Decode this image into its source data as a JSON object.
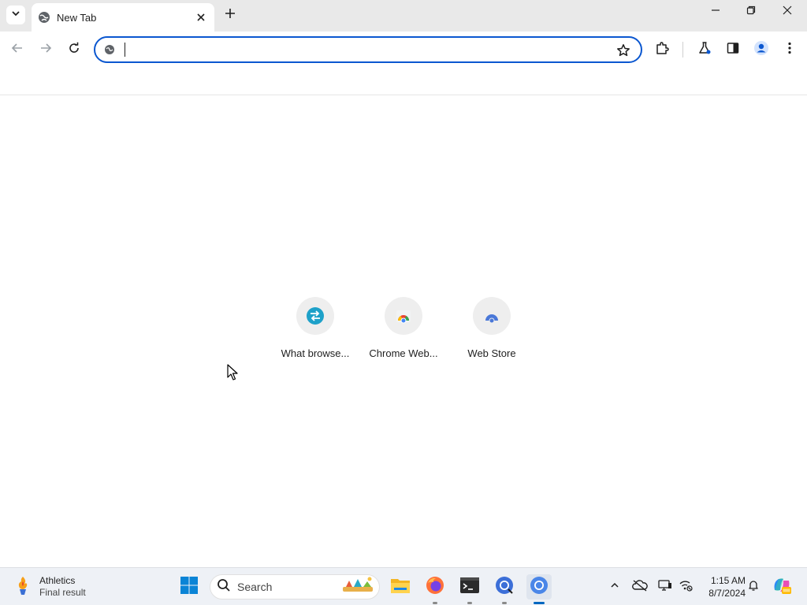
{
  "browser": {
    "tab": {
      "title": "New Tab",
      "close_icon": "close-icon",
      "favicon": "globe-icon"
    },
    "new_tab_icon": "plus-icon",
    "tab_search_icon": "chevron-down-icon",
    "window_controls": [
      "minimize-icon",
      "restore-icon",
      "close-icon"
    ],
    "toolbar": {
      "back_icon": "arrow-left-icon",
      "forward_icon": "arrow-right-icon",
      "reload_icon": "reload-icon",
      "omnibox_value": "",
      "omnibox_icon": "google-icon",
      "bookmark_icon": "star-icon",
      "extensions_icon": "puzzle-icon",
      "labs_icon": "flask-icon",
      "side_panel_icon": "side-panel-icon",
      "profile_icon": "person-icon",
      "menu_icon": "kebab-menu-icon"
    },
    "accent_color": "#0b57d0"
  },
  "shortcuts": [
    {
      "label": "What browse...",
      "icon": "globe-arrows-icon"
    },
    {
      "label": "Chrome Web...",
      "icon": "chrome-store-icon"
    },
    {
      "label": "Web Store",
      "icon": "webstore-icon"
    }
  ],
  "taskbar": {
    "widget": {
      "title": "Athletics",
      "subtitle": "Final result",
      "icon": "torch-icon"
    },
    "start_icon": "windows-icon",
    "search_label": "Search",
    "apps": [
      "file-explorer-icon",
      "firefox-icon",
      "terminal-icon",
      "chrome-canary-icon",
      "chrome-icon"
    ],
    "tray": [
      "chevron-up-icon",
      "onedrive-icon",
      "display-icon",
      "network-icon"
    ],
    "clock": {
      "time": "1:15 AM",
      "date": "8/7/2024"
    },
    "notification_icon": "bell-icon",
    "copilot_icon": "copilot-icon"
  }
}
